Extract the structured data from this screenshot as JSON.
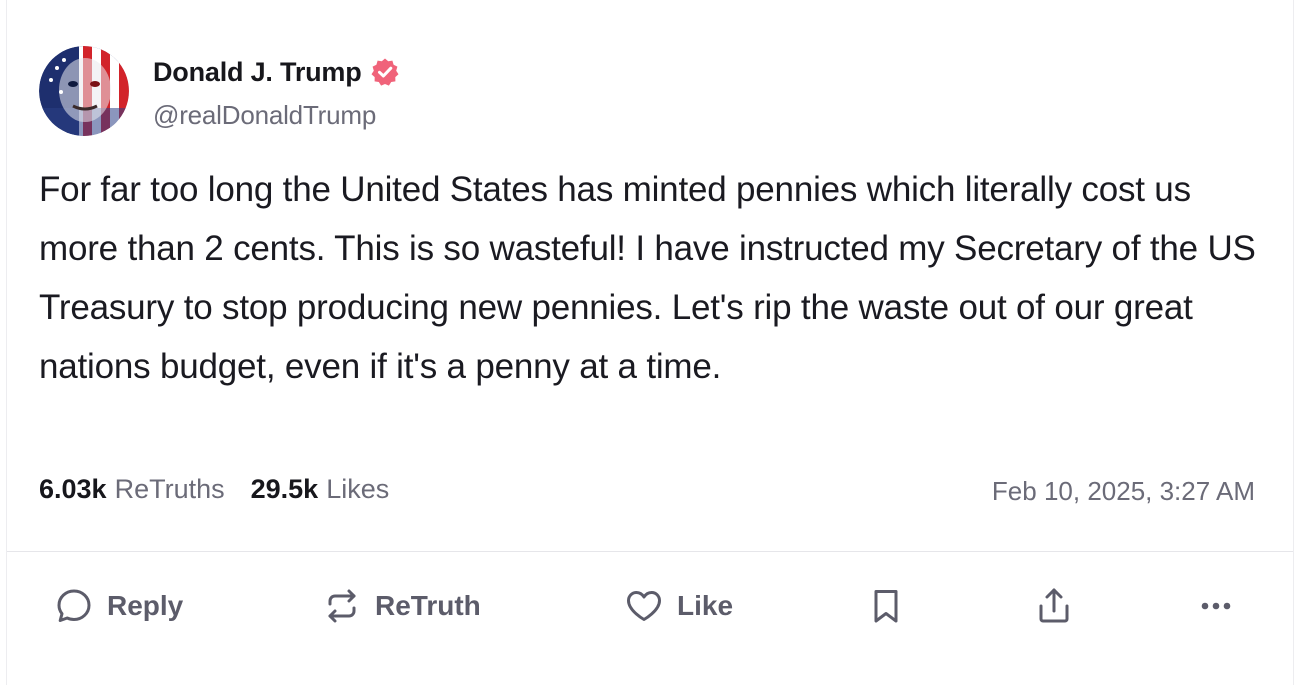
{
  "author": {
    "display_name": "Donald J. Trump",
    "handle": "@realDonaldTrump",
    "verified": true,
    "verified_color": "#f0637a",
    "avatar_icon": "avatar-flag-portrait"
  },
  "post": {
    "text": "For far too long the United States has minted pennies which literally cost us more than 2 cents. This is so wasteful! I have instructed my Secretary of the US Treasury to stop producing new pennies. Let's rip the waste out of our great nations budget, even if it's a penny at a time."
  },
  "stats": {
    "retruths_count": "6.03k",
    "retruths_label": "ReTruths",
    "likes_count": "29.5k",
    "likes_label": "Likes"
  },
  "timestamp": "Feb 10, 2025, 3:27 AM",
  "actions": {
    "reply_label": "Reply",
    "retruth_label": "ReTruth",
    "like_label": "Like",
    "icons": [
      "reply-icon",
      "retruth-icon",
      "like-icon",
      "bookmark-icon",
      "share-icon",
      "more-icon"
    ]
  },
  "colors": {
    "text_primary": "#17171c",
    "text_secondary": "#6b6b78",
    "action_gray": "#5c5c6a"
  }
}
